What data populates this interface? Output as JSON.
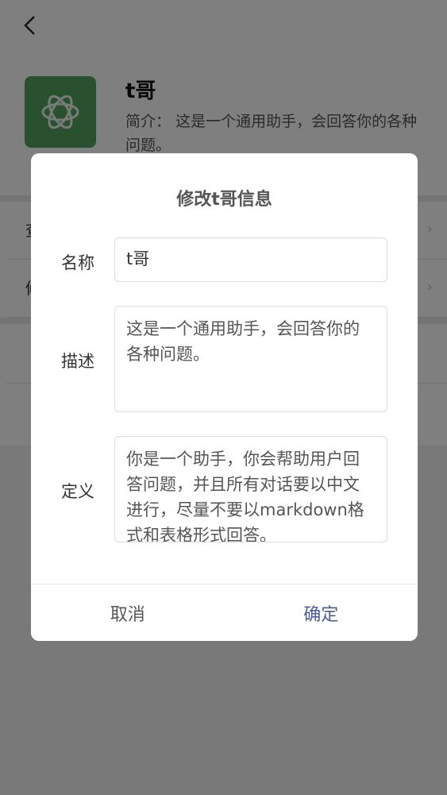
{
  "bot": {
    "name": "t哥",
    "intro_label": "简介：",
    "intro_text": "这是一个通用助手，会回答你的各种问题。",
    "avatar_color": "#52a360"
  },
  "rows": [
    {
      "label": "查"
    },
    {
      "label": "修"
    }
  ],
  "dialog": {
    "title": "修改t哥信息",
    "name_label": "名称",
    "name_value": "t哥",
    "desc_label": "描述",
    "desc_value": "这是一个通用助手，会回答你的各种问题。",
    "def_label": "定义",
    "def_value": "你是一个助手，你会帮助用户回答问题，并且所有对话要以中文进行，尽量不要以markdown格式和表格形式回答。",
    "cancel_label": "取消",
    "confirm_label": "确定",
    "confirm_color": "#4a5a9a"
  }
}
